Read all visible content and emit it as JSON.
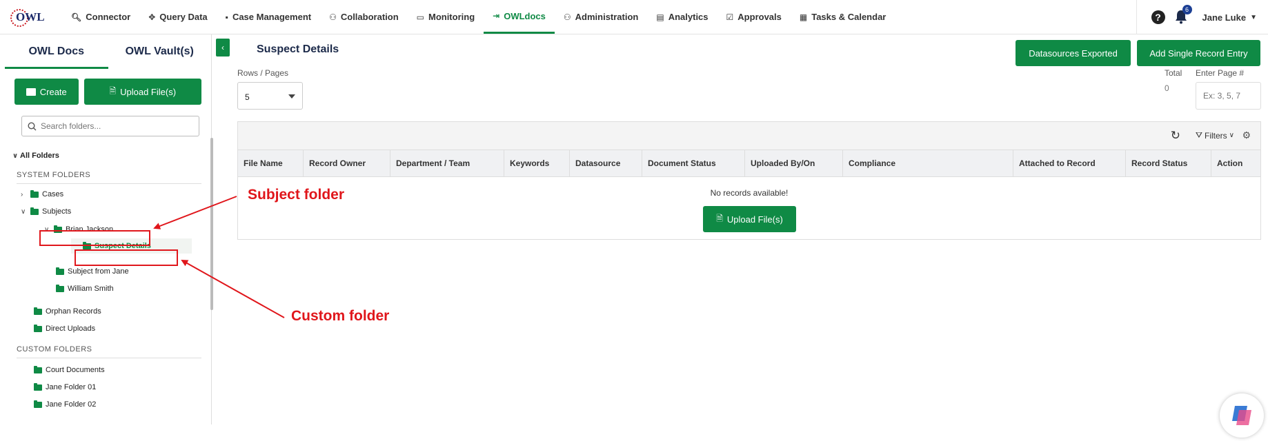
{
  "nav": {
    "items": [
      {
        "label": "Connector",
        "icon": "search-icon"
      },
      {
        "label": "Query Data",
        "icon": "move-icon"
      },
      {
        "label": "Case Management",
        "icon": "briefcase-icon"
      },
      {
        "label": "Collaboration",
        "icon": "users-icon"
      },
      {
        "label": "Monitoring",
        "icon": "monitor-icon"
      },
      {
        "label": "OWLdocs",
        "icon": "document-export-icon",
        "active": true
      },
      {
        "label": "Administration",
        "icon": "admin-icon"
      },
      {
        "label": "Analytics",
        "icon": "file-chart-icon"
      },
      {
        "label": "Approvals",
        "icon": "approvals-icon"
      },
      {
        "label": "Tasks & Calendar",
        "icon": "calendar-icon"
      }
    ],
    "help": "?",
    "notification_count": "6",
    "user_name": "Jane Luke",
    "logo_text": "OWL"
  },
  "sidebar": {
    "tabs": [
      "OWL Docs",
      "OWL Vault(s)"
    ],
    "create_label": "Create",
    "upload_label": "Upload File(s)",
    "search_placeholder": "Search folders...",
    "all_folders": "All Folders",
    "system_folders_label": "SYSTEM FOLDERS",
    "custom_folders_label": "CUSTOM FOLDERS",
    "system_folders": [
      "Cases",
      "Subjects",
      "Brian Jackson",
      "Suspect Details",
      "Subject from Jane",
      "William Smith",
      "Orphan Records",
      "Direct Uploads"
    ],
    "custom_folders": [
      "Court Documents",
      "Jane Folder 01",
      "Jane Folder 02"
    ]
  },
  "main": {
    "title": "Suspect Details",
    "datasources_exported": "Datasources Exported",
    "add_single_record": "Add Single Record Entry",
    "rows_pages_label": "Rows / Pages",
    "rows_value": "5",
    "total_label": "Total",
    "total_value": "0",
    "enter_page_label": "Enter Page #",
    "enter_page_placeholder": "Ex: 3, 5, 7",
    "filters_label": "Filters",
    "columns": [
      "File Name",
      "Record Owner",
      "Department / Team",
      "Keywords",
      "Datasource",
      "Document Status",
      "Uploaded By/On",
      "Compliance",
      "Attached to Record",
      "Record Status",
      "Action"
    ],
    "no_records": "No records available!",
    "upload_label": "Upload File(s)"
  },
  "annotations": {
    "subject_folder": "Subject folder",
    "custom_folder": "Custom folder"
  },
  "colors": {
    "brand_green": "#0f8a45",
    "annotation_red": "#e0161b",
    "navy": "#1c2a4a"
  }
}
